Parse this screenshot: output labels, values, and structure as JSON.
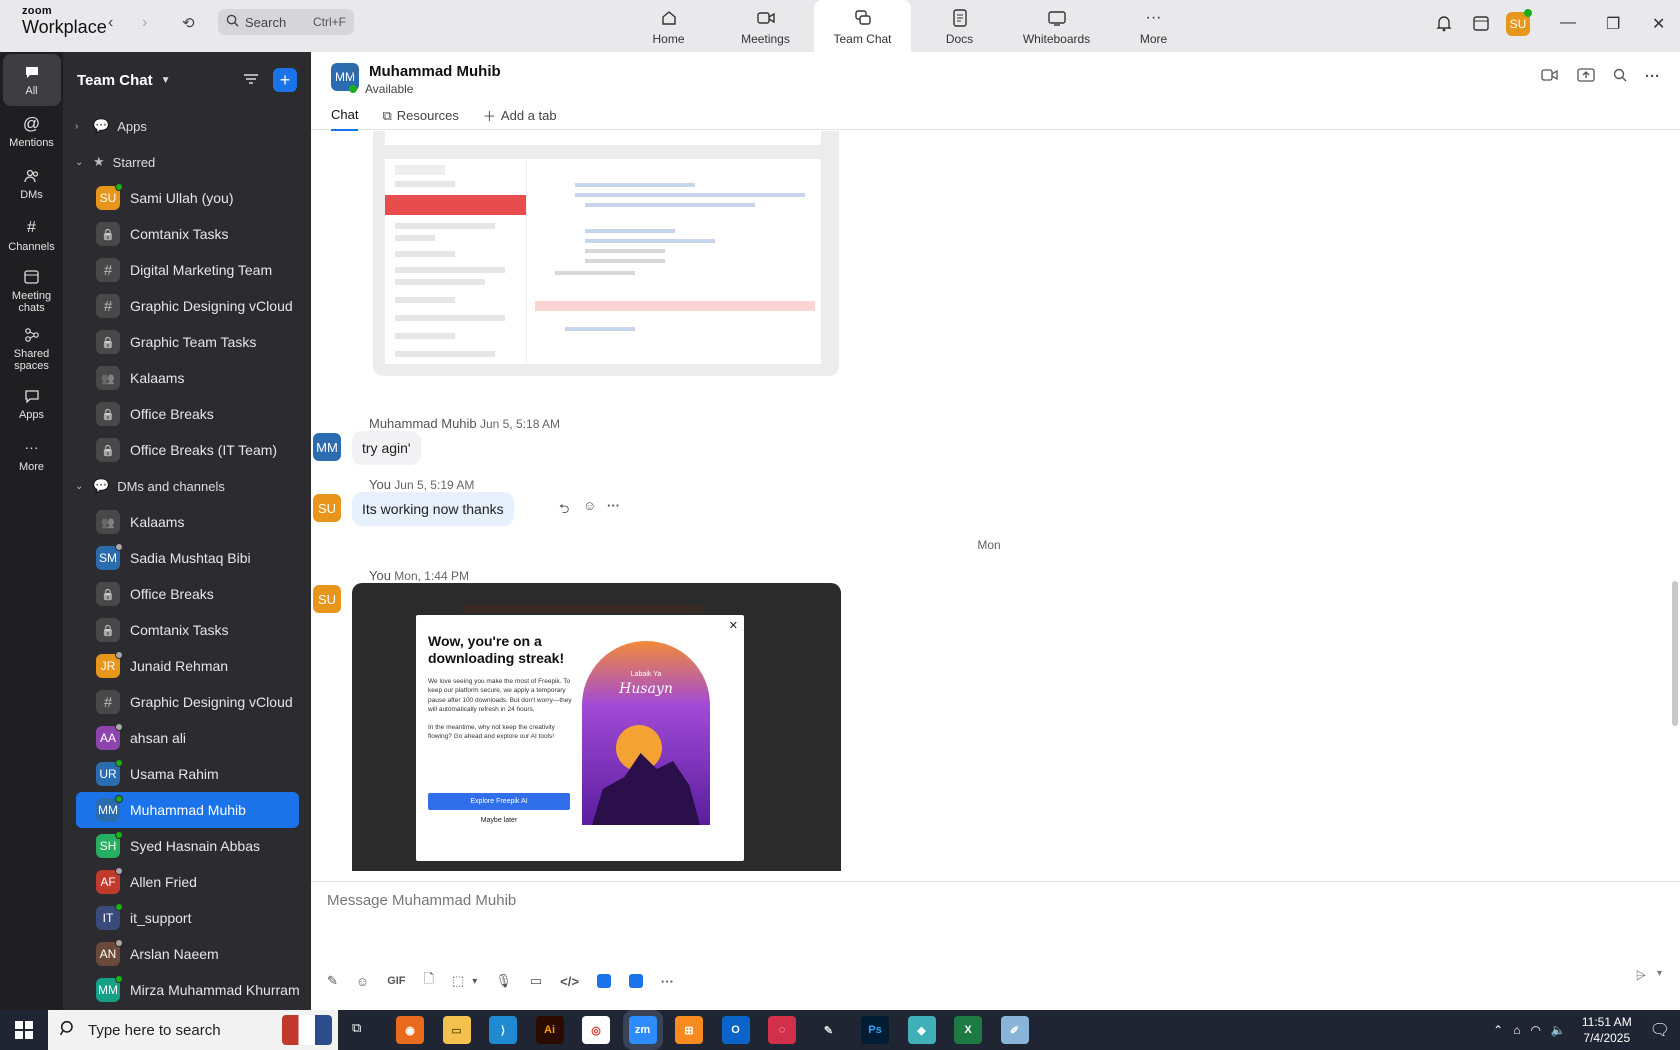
{
  "titlebar": {
    "brand_top": "zoom",
    "brand_bottom": "Workplace",
    "search_label": "Search",
    "search_shortcut": "Ctrl+F",
    "nav": [
      {
        "label": "Home",
        "icon": "home-icon"
      },
      {
        "label": "Meetings",
        "icon": "video-icon"
      },
      {
        "label": "Team Chat",
        "icon": "chat-icon",
        "active": true
      },
      {
        "label": "Docs",
        "icon": "doc-icon"
      },
      {
        "label": "Whiteboards",
        "icon": "whiteboard-icon"
      },
      {
        "label": "More",
        "icon": "more-icon"
      }
    ],
    "user_initials": "SU"
  },
  "rail": [
    {
      "label": "All",
      "icon": "chat-bubble-icon",
      "active": true
    },
    {
      "label": "Mentions",
      "icon": "at-icon"
    },
    {
      "label": "DMs",
      "icon": "people-icon"
    },
    {
      "label": "Channels",
      "icon": "hash-icon"
    },
    {
      "label": "Meeting chats",
      "icon": "calendar-icon"
    },
    {
      "label": "Shared spaces",
      "icon": "share-icon"
    },
    {
      "label": "Apps",
      "icon": "apps-icon"
    },
    {
      "label": "More",
      "icon": "more-icon"
    }
  ],
  "sidebar": {
    "title": "Team Chat",
    "sections": {
      "apps": "Apps",
      "starred": "Starred",
      "dms": "DMs and channels"
    },
    "starred": [
      {
        "label": "Sami Ullah (you)",
        "type": "avatar",
        "initials": "SU",
        "color": "#e8951c",
        "status": "#1bb01b"
      },
      {
        "label": "Comtanix Tasks",
        "type": "lock"
      },
      {
        "label": "Digital Marketing Team",
        "type": "hash"
      },
      {
        "label": "Graphic Designing vCloud",
        "type": "hash"
      },
      {
        "label": "Graphic Team Tasks",
        "type": "lock"
      },
      {
        "label": "Kalaams",
        "type": "group"
      },
      {
        "label": "Office Breaks",
        "type": "lock"
      },
      {
        "label": "Office Breaks (IT Team)",
        "type": "lock"
      }
    ],
    "dms": [
      {
        "label": "Kalaams",
        "type": "group"
      },
      {
        "label": "Sadia Mushtaq Bibi",
        "type": "avatar",
        "initials": "SM",
        "color": "#2b6cb0",
        "status": "#aaaaaa"
      },
      {
        "label": "Office Breaks",
        "type": "lock"
      },
      {
        "label": "Comtanix Tasks",
        "type": "lock"
      },
      {
        "label": "Junaid Rehman",
        "type": "avatar",
        "initials": "JR",
        "color": "#e8951c",
        "status": "#aaaaaa"
      },
      {
        "label": "Graphic Designing vCloud",
        "type": "hash"
      },
      {
        "label": "ahsan ali",
        "type": "avatar",
        "initials": "AA",
        "color": "#8e44ad",
        "status": "#aaaaaa"
      },
      {
        "label": "Usama Rahim",
        "type": "avatar",
        "initials": "UR",
        "color": "#2b6cb0",
        "status": "#1bb01b"
      },
      {
        "label": "Muhammad Muhib",
        "type": "avatar",
        "initials": "MM",
        "color": "#2b6cb0",
        "status": "#1bb01b",
        "active": true
      },
      {
        "label": "Syed Hasnain Abbas",
        "type": "avatar",
        "initials": "SH",
        "color": "#27ae60",
        "status": "#1bb01b"
      },
      {
        "label": "Allen Fried",
        "type": "avatar",
        "initials": "AF",
        "color": "#c0392b",
        "status": "#aaaaaa"
      },
      {
        "label": "it_support",
        "type": "avatar",
        "initials": "IT",
        "color": "#3a4a7a",
        "status": "#1bb01b"
      },
      {
        "label": "Arslan Naeem",
        "type": "avatar",
        "initials": "AN",
        "color": "#6b4a3a",
        "status": "#aaaaaa"
      },
      {
        "label": "Mirza Muhammad Khurram",
        "type": "avatar",
        "initials": "MM",
        "color": "#16a085",
        "status": "#1bb01b"
      }
    ]
  },
  "chat": {
    "initials": "MM",
    "name": "Muhammad Muhib",
    "status": "Available",
    "tabs": [
      "Chat",
      "Resources",
      "Add a tab"
    ],
    "messages": [
      {
        "sender": "Muhammad Muhib",
        "time": "Jun 5, 5:18 AM",
        "text": "try agin'",
        "initials": "MM"
      },
      {
        "sender": "You",
        "time": "Jun 5, 5:19 AM",
        "text": "Its working now thanks",
        "initials": "SU"
      }
    ],
    "day_separator": "Mon",
    "image_message": {
      "sender": "You",
      "time": "Mon, 1:44 PM",
      "initials": "SU"
    },
    "popup": {
      "title": "Wow, you're on a downloading streak!",
      "body1": "We love seeing you make the most of Freepik. To keep our platform secure, we apply a temporary pause after 100 downloads. But don't worry—they will automatically refresh in 24 hours.",
      "body2": "In the meantime, why not keep the creativity flowing? Go ahead and explore our AI tools!",
      "primary": "Explore Freepik AI",
      "secondary": "Maybe later",
      "art_title": "Husayn",
      "art_sub": "Labaik Ya"
    },
    "composer_placeholder": "Message Muhammad Muhib",
    "composer_tools": [
      "GIF"
    ]
  },
  "taskbar": {
    "search": "Type here to search",
    "time": "11:51 AM",
    "date": "7/4/2025",
    "apps": [
      "Firefox",
      "File Explorer",
      "VS Code",
      "Illustrator",
      "Chrome",
      "Zoom",
      "XAMPP",
      "Outlook",
      "Creative Cloud",
      "Pen",
      "Photoshop",
      "App",
      "Excel",
      "Notepad"
    ]
  }
}
